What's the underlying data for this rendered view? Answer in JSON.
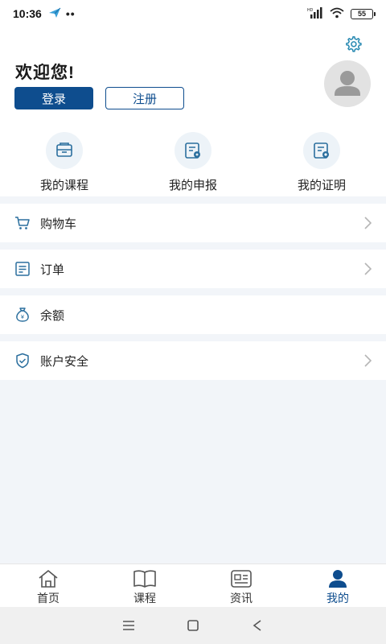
{
  "status_bar": {
    "time": "10:36",
    "battery": "55",
    "network": "HD"
  },
  "header": {
    "welcome": "欢迎您!",
    "login_label": "登录",
    "register_label": "注册"
  },
  "shortcuts": [
    {
      "label": "我的课程",
      "icon": "course-box-icon"
    },
    {
      "label": "我的申报",
      "icon": "declaration-icon"
    },
    {
      "label": "我的证明",
      "icon": "certificate-icon"
    }
  ],
  "menu": [
    {
      "label": "购物车",
      "icon": "cart-icon",
      "has_arrow": true
    },
    {
      "label": "订单",
      "icon": "order-icon",
      "has_arrow": true
    },
    {
      "label": "余额",
      "icon": "money-bag-icon",
      "has_arrow": false
    },
    {
      "label": "账户安全",
      "icon": "shield-icon",
      "has_arrow": true
    }
  ],
  "tabs": [
    {
      "label": "首页",
      "icon": "home-icon",
      "active": false
    },
    {
      "label": "课程",
      "icon": "book-icon",
      "active": false
    },
    {
      "label": "资讯",
      "icon": "news-icon",
      "active": false
    },
    {
      "label": "我的",
      "icon": "profile-icon",
      "active": true
    }
  ],
  "colors": {
    "primary": "#0e4d8e",
    "accent_icon": "#2b8bb3",
    "background": "#f2f5f9"
  }
}
